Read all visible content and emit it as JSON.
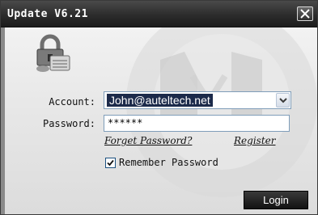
{
  "window": {
    "title": "Update V6.21"
  },
  "icons": {
    "close": "close-icon",
    "lock": "lock-icon",
    "dropdown": "chevron-down-icon",
    "check": "check-icon"
  },
  "form": {
    "account_label": "Account:",
    "account_value": "John@auteltech.net",
    "password_label": "Password:",
    "password_value": "******",
    "forgot_password": "Forget Password?",
    "register": "Register",
    "remember_label": "Remember Password",
    "remember_checked": true,
    "login_label": "Login"
  },
  "colors": {
    "titlebar": "#2c2c2c",
    "selection": "#1c2a4a",
    "login_button": "#1a1a1a"
  }
}
